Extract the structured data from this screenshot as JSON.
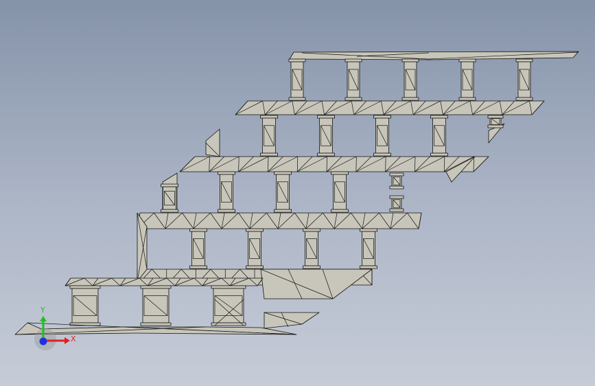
{
  "viewport": {
    "kind": "cad-3d-mesh-view",
    "background_top": "#8593a9",
    "background_bottom": "#c6ccd7",
    "face_color": "#c8c6ba",
    "edge_color": "#111111"
  },
  "triad": {
    "x_label": "X",
    "y_label": "Y",
    "x_color": "#e02020",
    "y_color": "#20c020",
    "z_color": "#2030e0"
  }
}
